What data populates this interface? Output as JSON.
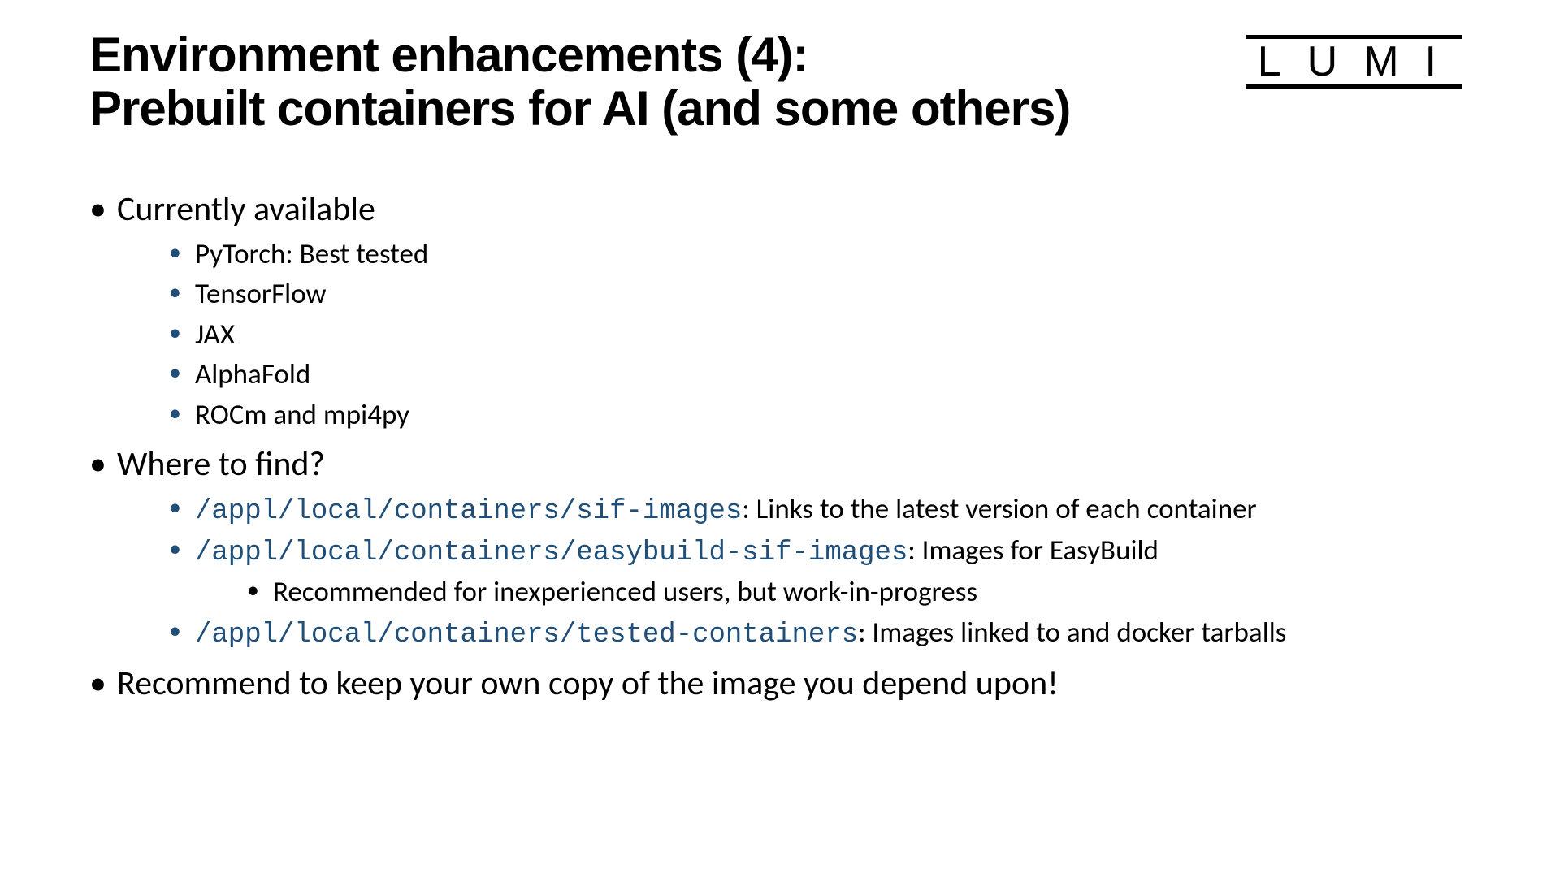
{
  "title_line1": "Environment enhancements (4):",
  "title_line2": "Prebuilt containers for AI (and some others)",
  "logo": "LUMI",
  "bul1": {
    "label": "Currently available",
    "items": {
      "a": "PyTorch: Best tested",
      "b": "TensorFlow",
      "c": "JAX",
      "d": "AlphaFold",
      "e": "ROCm and mpi4py"
    }
  },
  "bul2": {
    "label": "Where to find?",
    "i1": {
      "path": "/appl/local/containers/sif-images",
      "desc": ": Links to the latest version of each container"
    },
    "i2": {
      "path": "/appl/local/containers/easybuild-sif-images",
      "desc": ": Images for EasyBuild",
      "sub": "Recommended for inexperienced users, but work-in-progress"
    },
    "i3": {
      "path": "/appl/local/containers/tested-containers",
      "desc": ": Images linked to and docker tarballs"
    }
  },
  "bul3": {
    "label": "Recommend to keep your own copy of the image you depend upon!"
  }
}
